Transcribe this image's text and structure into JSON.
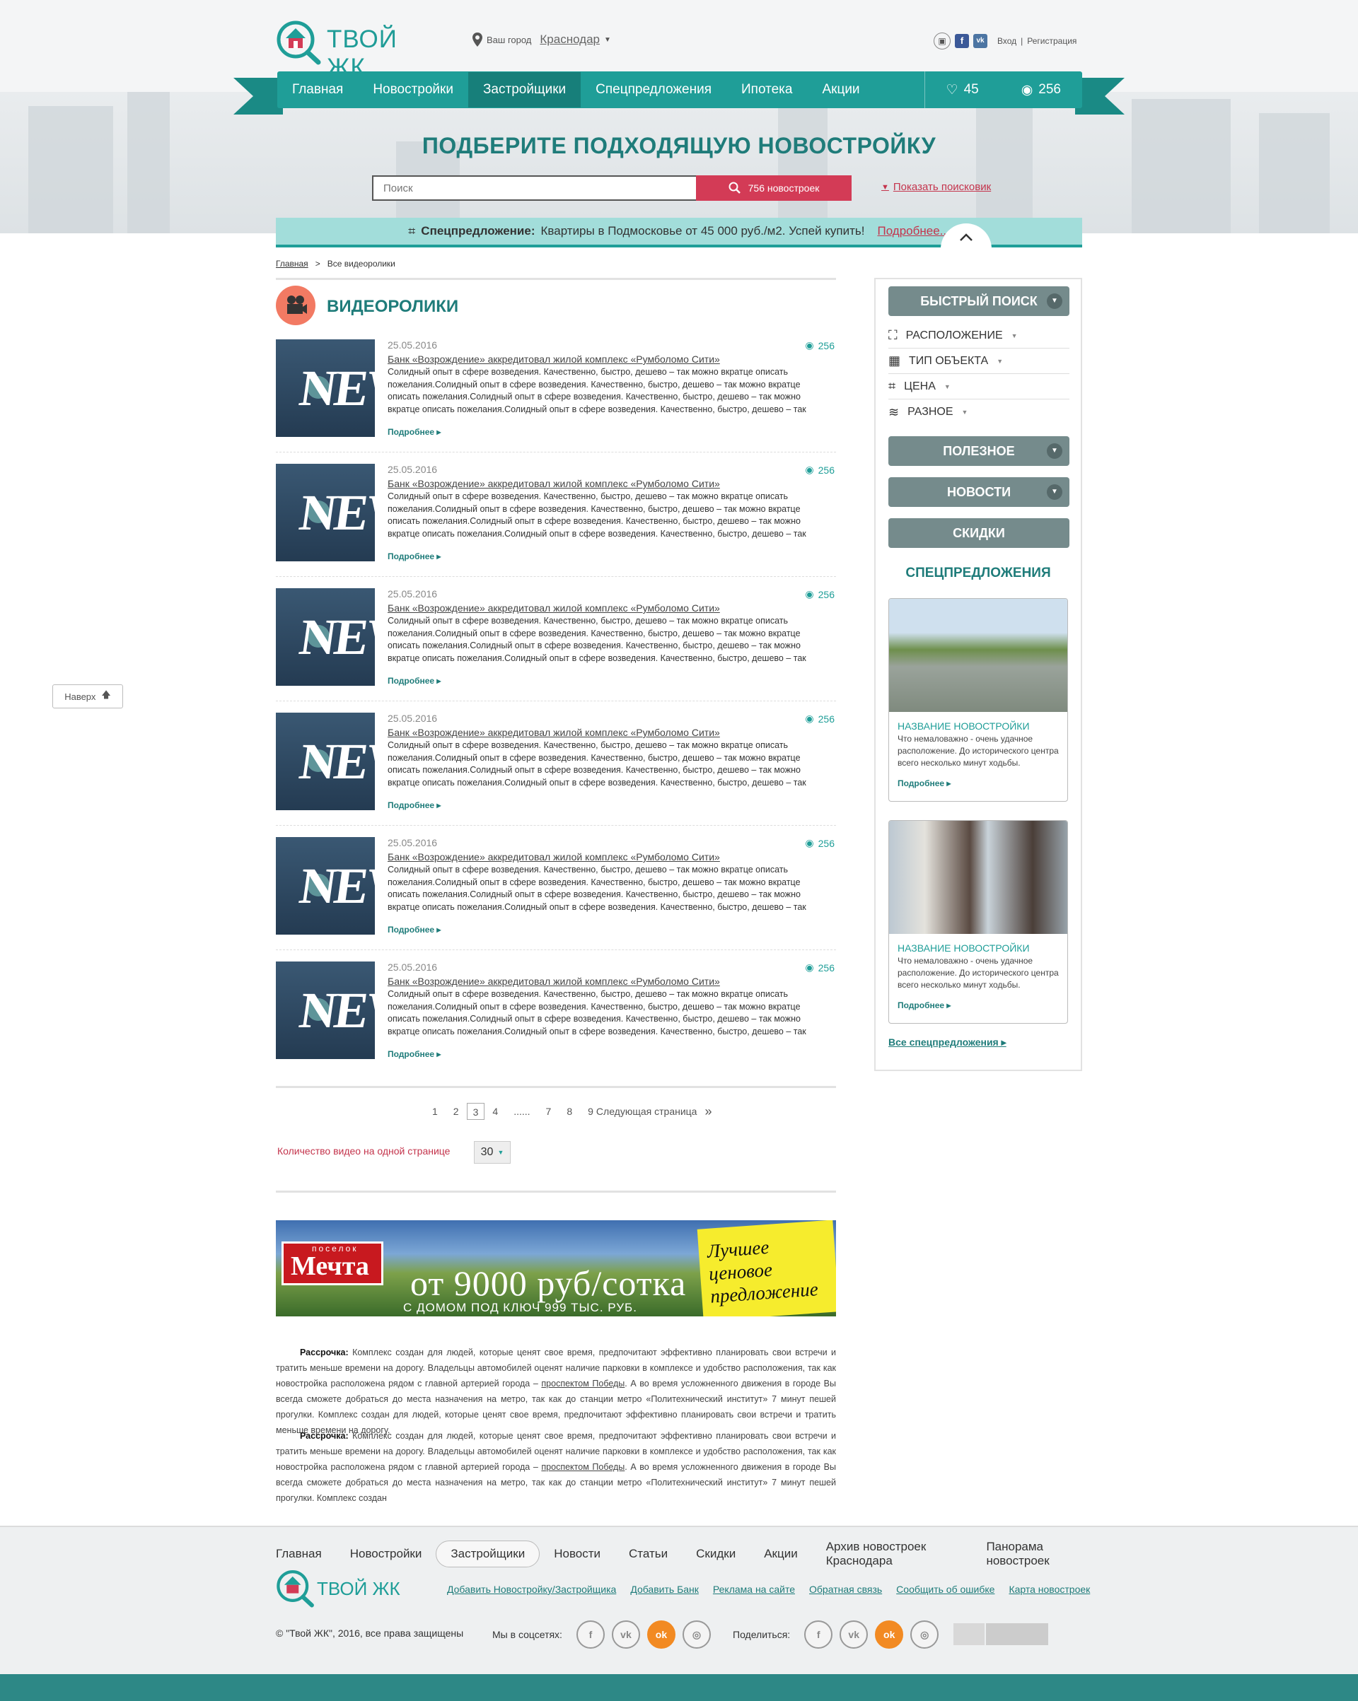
{
  "header": {
    "logo_text": "ТВОЙ ЖК",
    "city_label": "Ваш город",
    "city_value": "Краснодар",
    "login": "Вход",
    "separator": "|",
    "register": "Регистрация"
  },
  "nav": {
    "items": [
      "Главная",
      "Новостройки",
      "Застройщики",
      "Спецпредложения",
      "Ипотека",
      "Акции"
    ],
    "active_index": 2,
    "favorites_count": "45",
    "views_count": "256"
  },
  "hero": {
    "title": "ПОДБЕРИТЕ ПОДХОДЯЩУЮ НОВОСТРОЙКУ",
    "search_placeholder": "Поиск",
    "search_button": "756 новостроек",
    "show_search": "Показать поисковик"
  },
  "promo": {
    "label": "Спецпредложение:",
    "text": "Квартиры в Подмосковье от 45 000 руб./м2. Успей купить!",
    "more": "Подробнее..."
  },
  "breadcrumbs": {
    "home": "Главная",
    "sep": ">",
    "current": "Все видеоролики"
  },
  "main": {
    "title": "ВИДЕОРОЛИКИ",
    "items": [
      {
        "date": "25.05.2016",
        "views": "256",
        "headline": "Банк «Возрождение» аккредитовал жилой комплекс «Румболомо Сити»",
        "text": "Солидный опыт в сфере возведения. Качественно, быстро, дешево – так можно вкратце описать пожелания.Солидный опыт в сфере возведения. Качественно, быстро, дешево – так можно вкратце описать пожелания.Солидный опыт в сфере возведения. Качественно, быстро, дешево – так можно вкратце описать пожелания.Солидный опыт в сфере возведения. Качественно, быстро, дешево – так можно вкратце описать",
        "more": "Подробнее"
      },
      {
        "date": "25.05.2016",
        "views": "256",
        "headline": "Банк «Возрождение» аккредитовал жилой комплекс «Румболомо Сити»",
        "text": "Солидный опыт в сфере возведения. Качественно, быстро, дешево – так можно вкратце описать пожелания.Солидный опыт в сфере возведения. Качественно, быстро, дешево – так можно вкратце описать пожелания.Солидный опыт в сфере возведения. Качественно, быстро, дешево – так можно вкратце описать пожелания.Солидный опыт в сфере возведения. Качественно, быстро, дешево – так можно вкратце описать",
        "more": "Подробнее"
      },
      {
        "date": "25.05.2016",
        "views": "256",
        "headline": "Банк «Возрождение» аккредитовал жилой комплекс «Румболомо Сити»",
        "text": "Солидный опыт в сфере возведения. Качественно, быстро, дешево – так можно вкратце описать пожелания.Солидный опыт в сфере возведения. Качественно, быстро, дешево – так можно вкратце описать пожелания.Солидный опыт в сфере возведения. Качественно, быстро, дешево – так можно вкратце описать пожелания.Солидный опыт в сфере возведения. Качественно, быстро, дешево – так можно вкратце описать",
        "more": "Подробнее"
      },
      {
        "date": "25.05.2016",
        "views": "256",
        "headline": "Банк «Возрождение» аккредитовал жилой комплекс «Румболомо Сити»",
        "text": "Солидный опыт в сфере возведения. Качественно, быстро, дешево – так можно вкратце описать пожелания.Солидный опыт в сфере возведения. Качественно, быстро, дешево – так можно вкратце описать пожелания.Солидный опыт в сфере возведения. Качественно, быстро, дешево – так можно вкратце описать пожелания.Солидный опыт в сфере возведения. Качественно, быстро, дешево – так можно вкратце описать",
        "more": "Подробнее"
      },
      {
        "date": "25.05.2016",
        "views": "256",
        "headline": "Банк «Возрождение» аккредитовал жилой комплекс «Румболомо Сити»",
        "text": "Солидный опыт в сфере возведения. Качественно, быстро, дешево – так можно вкратце описать пожелания.Солидный опыт в сфере возведения. Качественно, быстро, дешево – так можно вкратце описать пожелания.Солидный опыт в сфере возведения. Качественно, быстро, дешево – так можно вкратце описать пожелания.Солидный опыт в сфере возведения. Качественно, быстро, дешево – так можно вкратце описать",
        "more": "Подробнее"
      },
      {
        "date": "25.05.2016",
        "views": "256",
        "headline": "Банк «Возрождение» аккредитовал жилой комплекс «Румболомо Сити»",
        "text": "Солидный опыт в сфере возведения. Качественно, быстро, дешево – так можно вкратце описать пожелания.Солидный опыт в сфере возведения. Качественно, быстро, дешево – так можно вкратце описать пожелания.Солидный опыт в сфере возведения. Качественно, быстро, дешево – так можно вкратце описать пожелания.Солидный опыт в сфере возведения. Качественно, быстро, дешево – так можно вкратце описать",
        "more": "Подробнее"
      }
    ],
    "pagination": {
      "pages": [
        "1",
        "2",
        "3",
        "4",
        "......",
        "7",
        "8",
        "9"
      ],
      "current": "3",
      "next": "Следующая страница",
      "next_arrow": "»"
    },
    "per_page_label": "Количество видео на одной странице",
    "per_page_value": "30"
  },
  "banner": {
    "logo_small": "поселок",
    "logo_big": "Мечта",
    "price": "от 9000 руб/сотка",
    "sub": "С ДОМОМ ПОД КЛЮЧ 999 ТЫС. РУБ.",
    "note": "Лучшее ценовое предложение"
  },
  "paragraphs": [
    {
      "label": "Рассрочка:",
      "text_a": "Комплекс создан для людей, которые ценят свое время, предпочитают эффективно планировать свои встречи и тратить меньше времени на дорогу. Владельцы автомобилей оценят наличие парковки в комплексе и удобство расположения, так как новостройка расположена рядом с главной артерией города –",
      "link": "проспектом Победы",
      "text_b": ". А во время усложненного движения в городе Вы всегда сможете добраться до места назначения на метро, так как до станции метро «Политехнический институт» 7 минут пешей прогулки. Комплекс создан для людей, которые ценят свое время, предпочитают эффективно планировать свои встречи и тратить меньше времени на дорогу."
    },
    {
      "label": "Рассрочка:",
      "text_a": "Комплекс создан для людей, которые ценят свое время, предпочитают эффективно планировать свои встречи и тратить меньше времени на дорогу. Владельцы автомобилей оценят наличие парковки в комплексе и удобство расположения, так как новостройка расположена рядом с главной артерией города –",
      "link": "проспектом Победы",
      "text_b": ". А во время усложненного движения в городе Вы всегда сможете добраться до места назначения на метро, так как до станции метро «Политехнический институт» 7 минут пешей прогулки. Комплекс создан"
    }
  ],
  "sidebar": {
    "quick_search": "БЫСТРЫЙ ПОИСК",
    "filters": [
      "РАСПОЛОЖЕНИЕ",
      "ТИП ОБЪЕКТА",
      "ЦЕНА",
      "РАЗНОЕ"
    ],
    "useful": "ПОЛЕЗНОЕ",
    "news": "НОВОСТИ",
    "discounts": "СКИДКИ",
    "special_title": "СПЕЦПРЕДЛОЖЕНИЯ",
    "cards": [
      {
        "name": "НАЗВАНИЕ НОВОСТРОЙКИ",
        "desc": "Что немаловажно - очень удачное расположение. До исторического центра всего несколько минут ходьбы.",
        "more": "Подробнее"
      },
      {
        "name": "НАЗВАНИЕ НОВОСТРОЙКИ",
        "desc": "Что немаловажно - очень удачное расположение. До исторического центра всего несколько минут ходьбы.",
        "more": "Подробнее"
      }
    ],
    "all_special": "Все спецпредложения"
  },
  "to_top": "Наверх",
  "footer": {
    "nav": [
      "Главная",
      "Новостройки",
      "Застройщики",
      "Новости",
      "Статьи",
      "Скидки",
      "Акции",
      "Архив новостроек Краснодара",
      "Панорама новостроек"
    ],
    "active_index": 2,
    "logo_text": "ТВОЙ ЖК",
    "links": [
      "Добавить Новостройку/Застройщика",
      "Добавить Банк",
      "Реклама на сайте",
      "Обратная связь",
      "Сообщить об ошибке",
      "Карта новостроек"
    ],
    "copyright": "© \"Твой ЖК\", 2016, все права защищены",
    "socials_label": "Мы в соцсетях:",
    "share_label": "Поделиться:"
  },
  "colors": {
    "teal": "#1f9e98",
    "teal_dark": "#177f7a",
    "accent_red": "#d33b56",
    "sidebar_btn": "#758b8c"
  }
}
